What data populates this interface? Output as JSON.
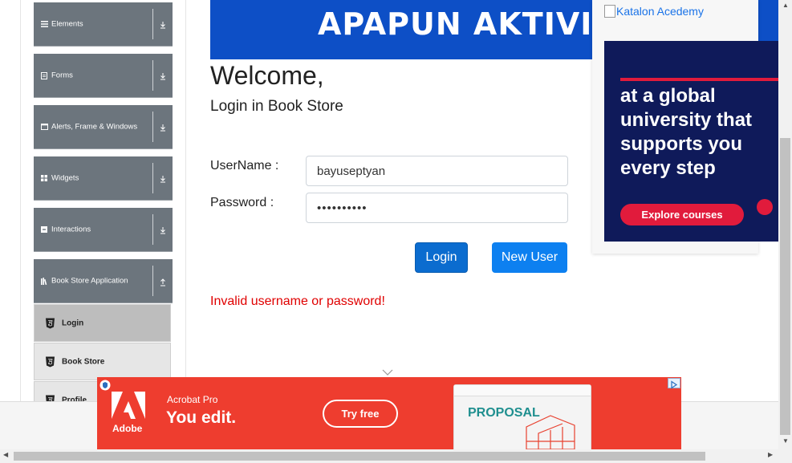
{
  "sidebar": {
    "groups": [
      {
        "label": "Elements",
        "icon": "list-icon"
      },
      {
        "label": "Forms",
        "icon": "form-icon"
      },
      {
        "label": "Alerts, Frame & Windows",
        "icon": "window-icon"
      },
      {
        "label": "Widgets",
        "icon": "widgets-icon"
      },
      {
        "label": "Interactions",
        "icon": "interactions-icon"
      },
      {
        "label": "Book Store Application",
        "icon": "book-icon"
      }
    ],
    "subitems": [
      {
        "label": "Login",
        "active": true
      },
      {
        "label": "Book Store",
        "active": false
      },
      {
        "label": "Profile",
        "active": false
      }
    ]
  },
  "banner": {
    "text": "APAPUN AKTIVITAS"
  },
  "main": {
    "welcome": "Welcome,",
    "subtitle": "Login in Book Store",
    "username_label": "UserName :",
    "username_value": "bayuseptyan",
    "password_label": "Password :",
    "password_value": "••••••••••",
    "login_button": "Login",
    "new_user_button": "New User",
    "error": "Invalid username or password!"
  },
  "ad_right": {
    "broken_image_alt": "Katalon Acedemy",
    "headline": "at a global university that supports you every step",
    "cta": "Explore courses"
  },
  "ad_bottom": {
    "brand": "Adobe",
    "product": "Acrobat Pro",
    "tagline": "You edit.",
    "cta": "Try free",
    "doc_title": "PROPOSAL"
  },
  "colors": {
    "sidebar_group": "#6c757d",
    "banner": "#0d4fc6",
    "primary_button": "#0b6ccf",
    "error": "#e00000",
    "ad_red": "#ee3d2f",
    "ad_navy": "#0f1a5a"
  }
}
